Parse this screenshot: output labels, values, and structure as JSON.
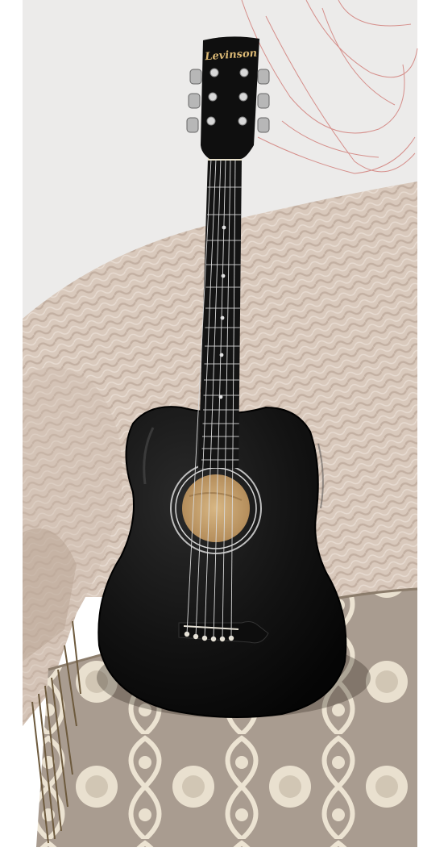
{
  "scene": {
    "brand_text": "Levinson"
  },
  "colors": {
    "wall": "#ecebea",
    "sofa": "#d9c9bc",
    "sofa_shadow": "#b9a596",
    "guitar_body": "#111111",
    "soundhole": "#d2ad78",
    "cushion": "#a89b8e",
    "cushion_pattern": "#ede4d3",
    "fringe": "#6d5a3d"
  }
}
